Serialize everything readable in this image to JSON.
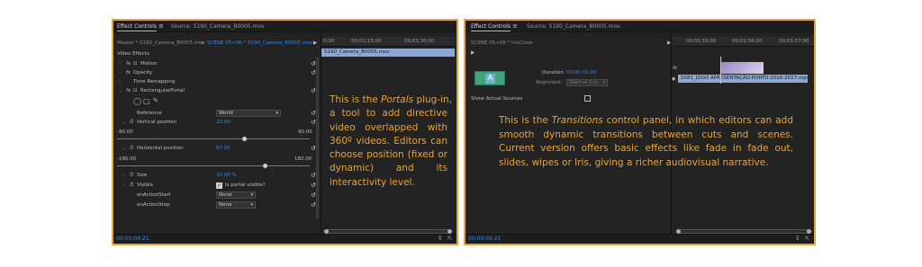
{
  "panel_left": {
    "tab_active": "Effect Controls",
    "tab_menu_icon": "≡",
    "tab_source": "Source: S190_Camera_B0005.mov",
    "master_label": "Master * S190_Camera_B0005.mov",
    "sequence_label": "SCENE 05+06 * S190_Camera_B0005.mov",
    "ruler_ticks": [
      "0:00",
      "00;01;15;00",
      "00;01;30;00"
    ],
    "clip_name": "S190_Camera_B0005.mov",
    "section_title": "Video Effects",
    "effects": [
      {
        "label": "Motion",
        "fx": "fx"
      },
      {
        "label": "Opacity",
        "fx": "fx"
      },
      {
        "label": "Time Remapping",
        "fx": ""
      },
      {
        "label": "RectangularPortal",
        "fx": "fx"
      }
    ],
    "reference_label": "Reference",
    "reference_value": "World",
    "vertical_label": "Vertical position",
    "vertical_value": "29.00",
    "vertical_min": "-90.00",
    "vertical_max": "90.00",
    "vertical_fraction": 0.66,
    "horizontal_label": "Horizontal position",
    "horizontal_value": "97.00",
    "horizontal_min": "-180.00",
    "horizontal_max": "180.00",
    "horizontal_fraction": 0.77,
    "size_label": "Size",
    "size_value": "30.00 %",
    "visible_label": "Visible",
    "visible_checkbox_label": "Is portal visible?",
    "on_action_start_label": "onActionStart",
    "on_action_start_value": "None",
    "on_action_stop_label": "onActionStop",
    "on_action_stop_value": "None",
    "timecode": "00:00:04:21",
    "overlay_lines": [
      [
        "This is the ",
        "Portals",
        " plug-in,"
      ],
      [
        "a tool to add directive"
      ],
      [
        "video overlapped with"
      ],
      [
        "360º videos. Editors can"
      ],
      [
        "choose position (fixed or"
      ],
      [
        "dynamic) and its"
      ],
      [
        "interactivity level."
      ]
    ]
  },
  "panel_right": {
    "tab_active": "Effect Controls",
    "tab_menu_icon": "≡",
    "tab_source": "Source: S190_Camera_B0005.mov",
    "sequence_label": "SCENE 05+06 * IrisClose",
    "ruler_ticks": [
      "00;01;55;00",
      "00;01;56;00",
      "00;01;57;00"
    ],
    "duration_label": "Duration",
    "duration_value": "00:00:01:00",
    "alignment_label": "Alignment:",
    "alignment_value": "Start at Cut",
    "show_sources_label": "Show Actual Sources",
    "clip_name": "S581_JOGO APRESENTAÇÃO  PORTO 2016-2017.mp4",
    "thumb_letter": "A",
    "timecode": "00:00:04:21",
    "overlay_lines": [
      [
        "This is the ",
        "Transitions",
        " control panel, in which editors can add"
      ],
      [
        "smooth dynamic transitions between cuts and scenes."
      ],
      [
        "Current version offers basic effects like  fade in fade out,"
      ],
      [
        "slides, wipes or Iris, giving a richer audiovisual narrative."
      ]
    ]
  },
  "colors": {
    "accent_border": "#e8a33a",
    "timecode_blue": "#2d8ceb",
    "clip_blue": "#8fa8d2"
  }
}
